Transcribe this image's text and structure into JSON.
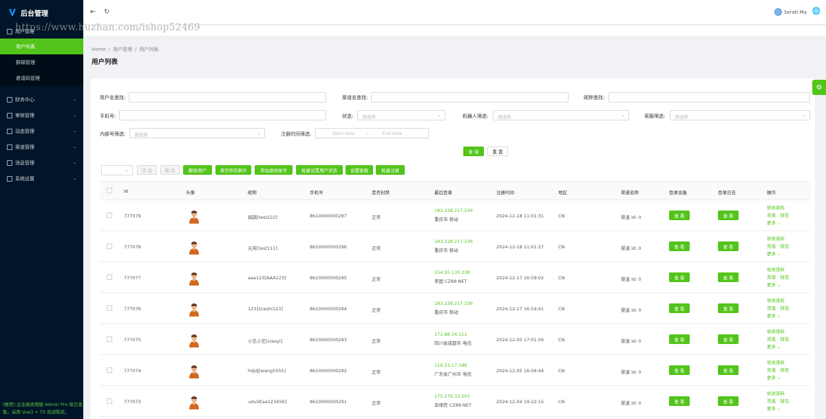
{
  "app": {
    "title": "后台管理",
    "watermark": "https://www.huzhan.com/ishop52469"
  },
  "sidebar": {
    "top_item": "用户管理",
    "sub_items": [
      "用户列表",
      "群聊管理",
      "邀请码管理"
    ],
    "menus": [
      "财务中心",
      "审核管理",
      "动态管理",
      "渠道管理",
      "消息管理",
      "系统设置"
    ],
    "footer": "(推荐) 企业级商用版 Admin Pro 现已发售。采用 Vue3 + TS 欢迎购买。"
  },
  "topbar": {
    "user_name": "Serati Ma"
  },
  "breadcrumb": [
    "Home",
    "用户管理",
    "用户列表"
  ],
  "page_title": "用户列表",
  "filters": {
    "username_label": "用户名查找:",
    "channel_label": "渠道名查找:",
    "nickname_label": "昵称查找:",
    "phone_label": "手机号:",
    "status_label": "状态:",
    "robot_label": "机器人筛选:",
    "service_label": "客服筛选:",
    "internal_label": "内部号筛选:",
    "regtime_label": "注册时间筛选:",
    "select_placeholder": "请选择",
    "start_date": "Start date",
    "end_date": "End date",
    "date_sep": "~",
    "search_btn": "查 询",
    "reset_btn": "重 置"
  },
  "toolbar": {
    "add": "添 加",
    "delete": "删 除",
    "actions": [
      "删除用户",
      "清空所有聊天",
      "添加虚拟账号",
      "批量设置用户状态",
      "设置客服",
      "批量注册"
    ]
  },
  "table": {
    "headers": [
      "id",
      "头像",
      "昵称",
      "手机号",
      "是否封禁",
      "最后登录",
      "注册时间",
      "地区",
      "渠道名称",
      "登录设备",
      "登录日志",
      "操作"
    ],
    "view_label": "查 看",
    "op_edit": "修改资料",
    "op_recharge": "充值",
    "op_wallet": "钱包",
    "op_more": "更多",
    "rows": [
      {
        "id": "777079",
        "nickname": "扁鹊[test222]",
        "phone": "8610000000297",
        "status": "正常",
        "ip": "183.228.217.236",
        "loc": "重庆市 移动",
        "reg": "2024-12-18 11:01:31",
        "region": "CN",
        "channel": "渠道 Id: 0"
      },
      {
        "id": "777078",
        "nickname": "元芳[test111]",
        "phone": "8610000000296",
        "status": "正常",
        "ip": "183.228.217.236",
        "loc": "重庆市 移动",
        "reg": "2024-12-18 11:01:27",
        "region": "CN",
        "channel": "渠道 Id: 0"
      },
      {
        "id": "777077",
        "nickname": "aaa123[AAA123]",
        "phone": "8610000000295",
        "status": "正常",
        "ip": "154.55.135.238",
        "loc": "美国 CZ88.NET",
        "reg": "2024-12-17 16:59:02",
        "region": "CN",
        "channel": "渠道 Id: 0"
      },
      {
        "id": "777076",
        "nickname": "1231[ceshi123]",
        "phone": "8610000000294",
        "status": "正常",
        "ip": "183.228.217.236",
        "loc": "重庆市 移动",
        "reg": "2024-12-17 16:54:41",
        "region": "CN",
        "channel": "渠道 Id: 0"
      },
      {
        "id": "777075",
        "nickname": "小艺小艺[xiaoyi]",
        "phone": "8610000000293",
        "status": "正常",
        "ip": "171.88.34.111",
        "loc": "四川省成都市 电信",
        "reg": "2024-12-05 17:01:56",
        "region": "CN",
        "channel": "渠道 Id: 0"
      },
      {
        "id": "777074",
        "nickname": "hdjdj[wang5555]",
        "phone": "8610000000292",
        "status": "正常",
        "ip": "116.23.17.188",
        "loc": "广东省广州市 电信",
        "reg": "2024-12-05 16:56:44",
        "region": "CN",
        "channel": "渠道 Id: 0"
      },
      {
        "id": "777073",
        "nickname": "uduld[aa123456]",
        "phone": "8610000000291",
        "status": "正常",
        "ip": "175.176.33.207",
        "loc": "菲律宾 CZ88.NET",
        "reg": "2024-12-04 19:22:15",
        "region": "CN",
        "channel": "渠道 Id: 0"
      }
    ]
  }
}
